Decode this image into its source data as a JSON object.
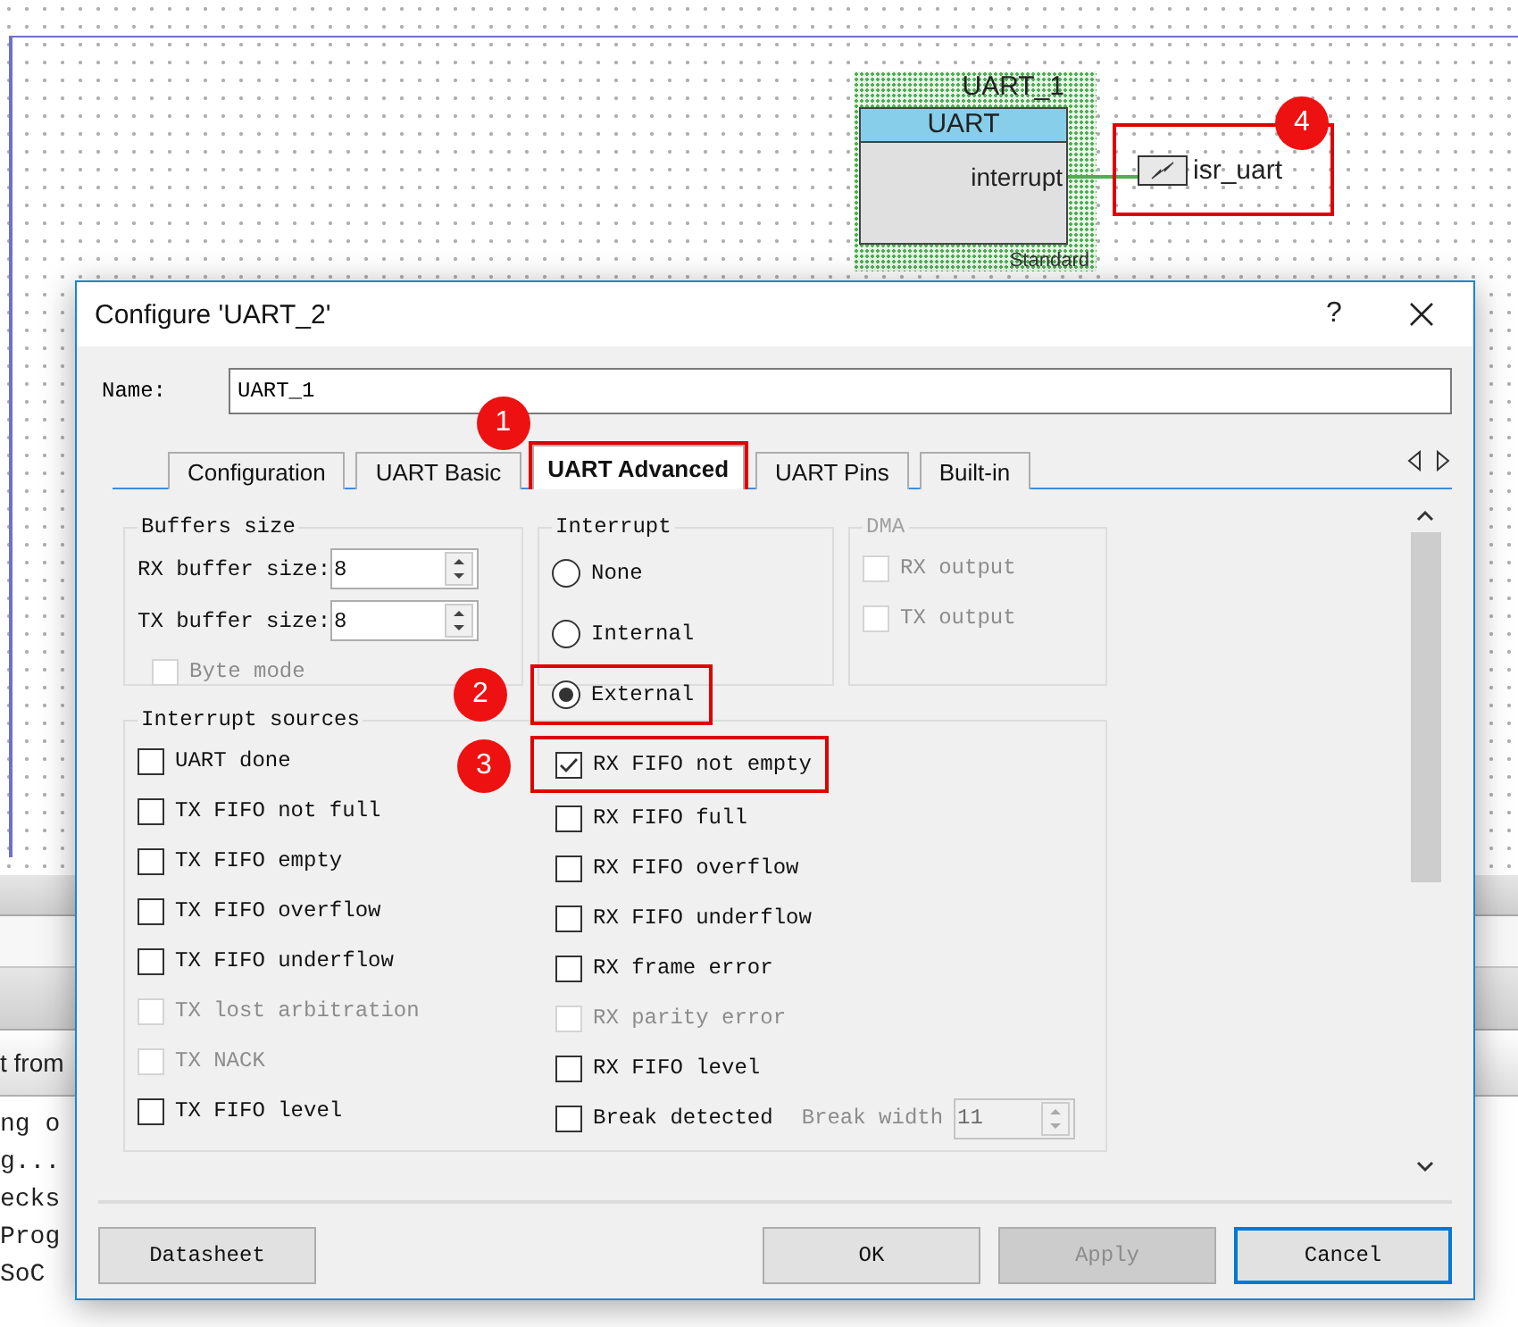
{
  "canvas": {
    "component": {
      "instance": "UART_1",
      "title": "UART",
      "terminal": "interrupt",
      "footer": "Standard"
    },
    "isr": {
      "label": "isr_uart",
      "highlighted": true,
      "marker": "4"
    }
  },
  "console": {
    "tab": "t from",
    "lines": [
      "ng o",
      "g...",
      "ecks",
      "Prog",
      "SoC"
    ]
  },
  "dialog": {
    "title": "Configure 'UART_2'",
    "help": "?",
    "name": {
      "label": "Name:",
      "value": "UART_1"
    },
    "tabs": [
      {
        "label": "Configuration",
        "selected": false,
        "highlighted": false
      },
      {
        "label": "UART Basic",
        "selected": false,
        "highlighted": false
      },
      {
        "label": "UART Advanced",
        "selected": true,
        "highlighted": true,
        "marker": "1"
      },
      {
        "label": "UART Pins",
        "selected": false,
        "highlighted": false
      },
      {
        "label": "Built-in",
        "selected": false,
        "highlighted": false
      }
    ],
    "buffers": {
      "title": "Buffers size",
      "fields": [
        {
          "label": "RX buffer size:",
          "value": "8"
        },
        {
          "label": "TX buffer size:",
          "value": "8"
        }
      ],
      "byte_mode": {
        "label": "Byte mode",
        "checked": false,
        "disabled": true
      }
    },
    "interrupt": {
      "title": "Interrupt",
      "options": [
        {
          "label": "None",
          "selected": false,
          "highlighted": false
        },
        {
          "label": "Internal",
          "selected": false,
          "highlighted": false
        },
        {
          "label": "External",
          "selected": true,
          "highlighted": true,
          "marker": "2"
        }
      ]
    },
    "dma": {
      "title": "DMA",
      "disabled": true,
      "options": [
        {
          "label": "RX output",
          "checked": false,
          "disabled": true
        },
        {
          "label": "TX output",
          "checked": false,
          "disabled": true
        }
      ]
    },
    "sources": {
      "title": "Interrupt sources",
      "left": [
        {
          "label": "UART done",
          "checked": false,
          "disabled": false
        },
        {
          "label": "TX FIFO not full",
          "checked": false,
          "disabled": false
        },
        {
          "label": "TX FIFO empty",
          "checked": false,
          "disabled": false
        },
        {
          "label": "TX FIFO overflow",
          "checked": false,
          "disabled": false
        },
        {
          "label": "TX FIFO underflow",
          "checked": false,
          "disabled": false
        },
        {
          "label": "TX lost arbitration",
          "checked": false,
          "disabled": true
        },
        {
          "label": "TX NACK",
          "checked": false,
          "disabled": true
        },
        {
          "label": "TX FIFO level",
          "checked": false,
          "disabled": false
        }
      ],
      "right": [
        {
          "label": "RX FIFO not empty",
          "checked": true,
          "disabled": false,
          "highlighted": true,
          "marker": "3"
        },
        {
          "label": "RX FIFO full",
          "checked": false,
          "disabled": false
        },
        {
          "label": "RX FIFO overflow",
          "checked": false,
          "disabled": false
        },
        {
          "label": "RX FIFO underflow",
          "checked": false,
          "disabled": false
        },
        {
          "label": "RX frame error",
          "checked": false,
          "disabled": false
        },
        {
          "label": "RX parity error",
          "checked": false,
          "disabled": true
        },
        {
          "label": "RX FIFO level",
          "checked": false,
          "disabled": false
        },
        {
          "label": "Break detected",
          "checked": false,
          "disabled": false,
          "extra": {
            "label": "Break width",
            "value": "11",
            "disabled": true
          }
        }
      ]
    },
    "buttons": [
      {
        "label": "Datasheet",
        "kind": "aside",
        "disabled": false,
        "default": false
      },
      {
        "label": "OK",
        "kind": "action",
        "disabled": false,
        "default": false
      },
      {
        "label": "Apply",
        "kind": "action",
        "disabled": true,
        "default": false
      },
      {
        "label": "Cancel",
        "kind": "action",
        "disabled": false,
        "default": true
      }
    ]
  }
}
